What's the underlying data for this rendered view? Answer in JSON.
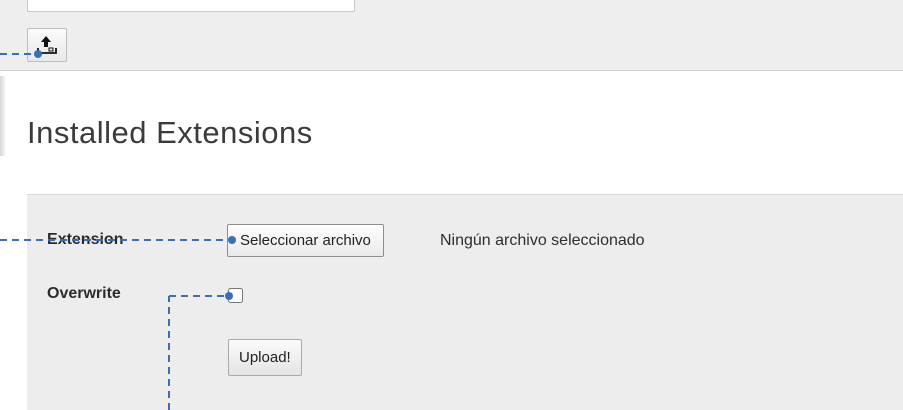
{
  "colors": {
    "toolbar_bg": "#eeeeee",
    "panel_bg": "#ededed",
    "annotation_line": "#3a6fb4"
  },
  "toolbar": {
    "upload_icon": "upload-tray-icon"
  },
  "page": {
    "title": "Installed Extensions"
  },
  "upload_form": {
    "extension_label": "Extension",
    "file_button_label": "Seleccionar archivo",
    "file_status": "Ningún archivo seleccionado",
    "overwrite_label": "Overwrite",
    "overwrite_checked": false,
    "upload_button_label": "Upload!"
  }
}
